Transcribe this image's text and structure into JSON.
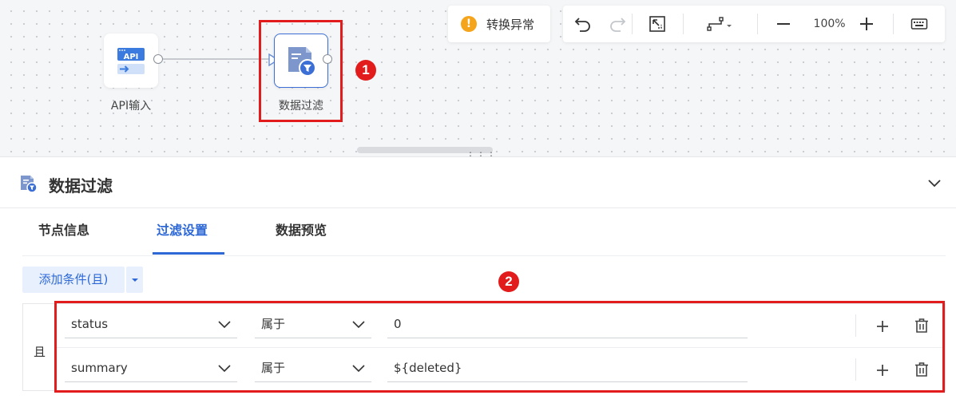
{
  "canvas": {
    "nodes": [
      {
        "id": "api",
        "label": "API输入",
        "icon": "api-input-icon"
      },
      {
        "id": "filter",
        "label": "数据过滤",
        "icon": "data-filter-icon"
      }
    ],
    "badges": [
      "1",
      "2"
    ],
    "highlight_color": "#e21c1c"
  },
  "toolbar": {
    "warning_text": "转换异常",
    "zoom": "100%",
    "icons": [
      "undo-icon",
      "redo-icon",
      "fit-view-icon",
      "connector-style-icon",
      "zoom-out-icon",
      "zoom-in-icon",
      "keyboard-icon"
    ]
  },
  "panel": {
    "title": "数据过滤",
    "tabs": [
      "节点信息",
      "过滤设置",
      "数据预览"
    ],
    "active_tab": "过滤设置",
    "add_condition_label": "添加条件(且)",
    "logic_label": "且",
    "conditions": [
      {
        "field": "status",
        "operator": "属于",
        "value": "0"
      },
      {
        "field": "summary",
        "operator": "属于",
        "value": "${deleted}"
      }
    ]
  },
  "colors": {
    "accent": "#2d68d6",
    "warning": "#f4a51c",
    "annotation": "#e21c1c"
  }
}
